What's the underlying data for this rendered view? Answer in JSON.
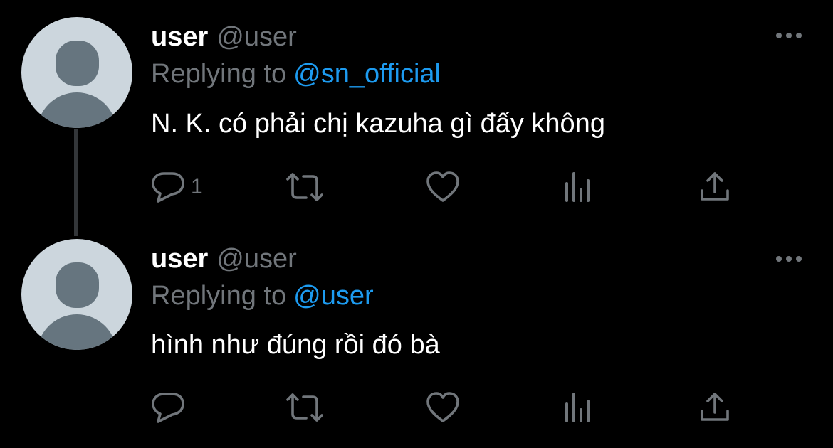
{
  "thread": {
    "tweets": [
      {
        "name": "user",
        "handle": "@user",
        "replying_prefix": "Replying to",
        "replying_to": "@sn_official",
        "text": "N. K. có phải chị kazuha gì đấy không",
        "reply_count": "1",
        "icons": [
          "more-icon",
          "reply-icon",
          "retweet-icon",
          "like-icon",
          "views-icon",
          "share-icon"
        ]
      },
      {
        "name": "user",
        "handle": "@user",
        "replying_prefix": "Replying to",
        "replying_to": "@user",
        "text": "hình như đúng rồi đó bà",
        "reply_count": "",
        "icons": [
          "more-icon",
          "reply-icon",
          "retweet-icon",
          "like-icon",
          "views-icon",
          "share-icon"
        ]
      }
    ]
  },
  "colors": {
    "background": "#000000",
    "text_primary": "#ffffff",
    "text_secondary": "#71767b",
    "link": "#1d9bf0",
    "avatar_bg": "#ccd6dd",
    "avatar_fg": "#66757f",
    "thread_line": "#333639"
  }
}
